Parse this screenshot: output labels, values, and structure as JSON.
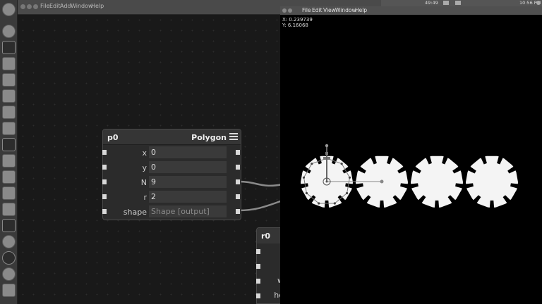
{
  "topbar": {
    "menu": [
      "File",
      "Edit",
      "Add",
      "Window",
      "Help"
    ]
  },
  "tray": {
    "clock": "49:49",
    "time": "10:56 PM"
  },
  "node_p0": {
    "name": "p0",
    "type": "Polygon",
    "params": [
      {
        "label": "x",
        "value": "0"
      },
      {
        "label": "y",
        "value": "0"
      },
      {
        "label": "N",
        "value": "9"
      },
      {
        "label": "r",
        "value": "2"
      },
      {
        "label": "shape",
        "value": "Shape [output]"
      }
    ]
  },
  "node_r0": {
    "name": "r0",
    "labels": [
      "w",
      "he"
    ]
  },
  "viewer": {
    "menu": [
      "File",
      "Edit",
      "View",
      "Window",
      "Help"
    ],
    "coord_x": "X: 0.239739",
    "coord_y": "Y: 6.16068"
  },
  "colors": {
    "canvas": "#191919",
    "node": "#2b2b2b",
    "viewer": "#000000",
    "shape": "#f4f4f4"
  }
}
